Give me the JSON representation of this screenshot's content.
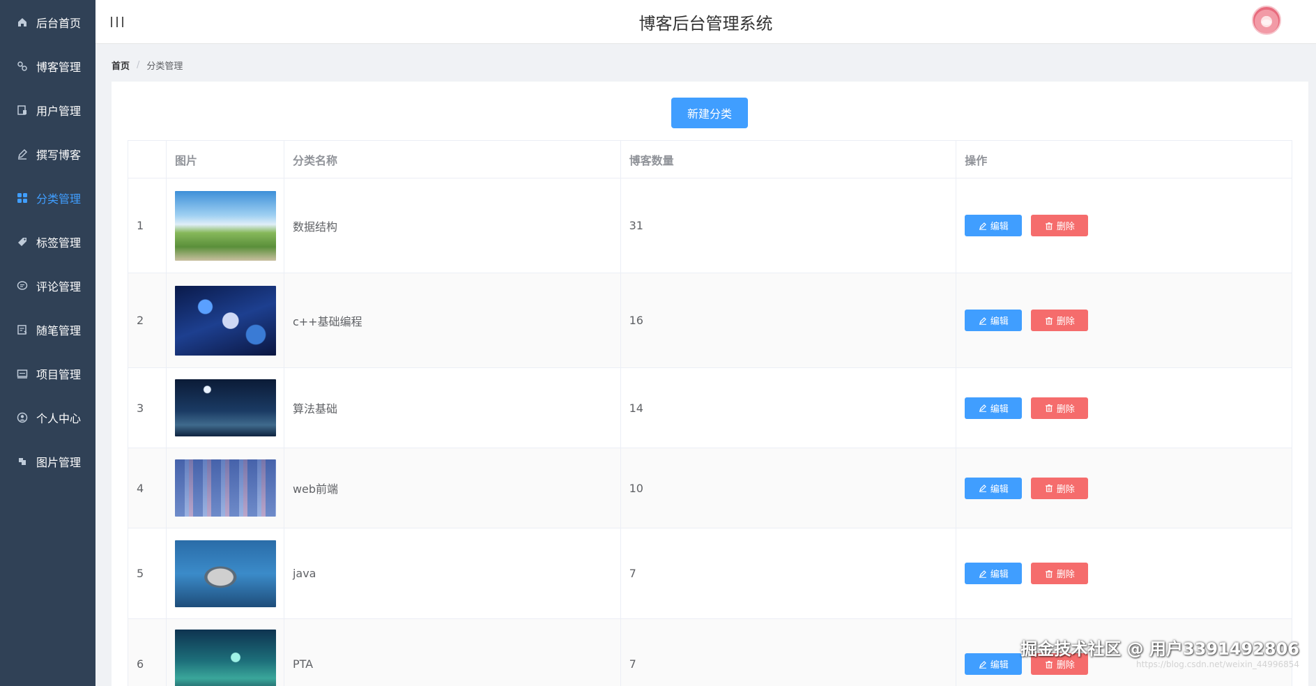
{
  "sidebar": {
    "items": [
      {
        "label": "后台首页",
        "icon": "home-icon",
        "active": false
      },
      {
        "label": "博客管理",
        "icon": "blog-icon",
        "active": false
      },
      {
        "label": "用户管理",
        "icon": "user-icon",
        "active": false
      },
      {
        "label": "撰写博客",
        "icon": "pen-icon",
        "active": false
      },
      {
        "label": "分类管理",
        "icon": "grid-icon",
        "active": true
      },
      {
        "label": "标签管理",
        "icon": "tag-icon",
        "active": false
      },
      {
        "label": "评论管理",
        "icon": "comment-icon",
        "active": false
      },
      {
        "label": "随笔管理",
        "icon": "note-icon",
        "active": false
      },
      {
        "label": "项目管理",
        "icon": "project-icon",
        "active": false
      },
      {
        "label": "个人中心",
        "icon": "profile-icon",
        "active": false
      },
      {
        "label": "图片管理",
        "icon": "image-icon",
        "active": false
      }
    ]
  },
  "header": {
    "title": "博客后台管理系统"
  },
  "breadcrumb": {
    "home": "首页",
    "separator": "/",
    "current": "分类管理"
  },
  "toolbar": {
    "new_label": "新建分类"
  },
  "table": {
    "columns": [
      "",
      "图片",
      "分类名称",
      "博客数量",
      "操作"
    ],
    "rows": [
      {
        "index": "1",
        "name": "数据结构",
        "count": "31"
      },
      {
        "index": "2",
        "name": "c++基础编程",
        "count": "16"
      },
      {
        "index": "3",
        "name": "算法基础",
        "count": "14"
      },
      {
        "index": "4",
        "name": "web前端",
        "count": "10"
      },
      {
        "index": "5",
        "name": "java",
        "count": "7"
      },
      {
        "index": "6",
        "name": "PTA",
        "count": "7"
      }
    ],
    "edit_label": "编辑",
    "delete_label": "删除"
  },
  "watermark": {
    "main": "掘金技术社区 @ 用户3391492806",
    "sub": "https://blog.csdn.net/weixin_44996854"
  },
  "colors": {
    "sidebar_bg": "#304156",
    "accent": "#409eff",
    "danger": "#f56c6c"
  }
}
